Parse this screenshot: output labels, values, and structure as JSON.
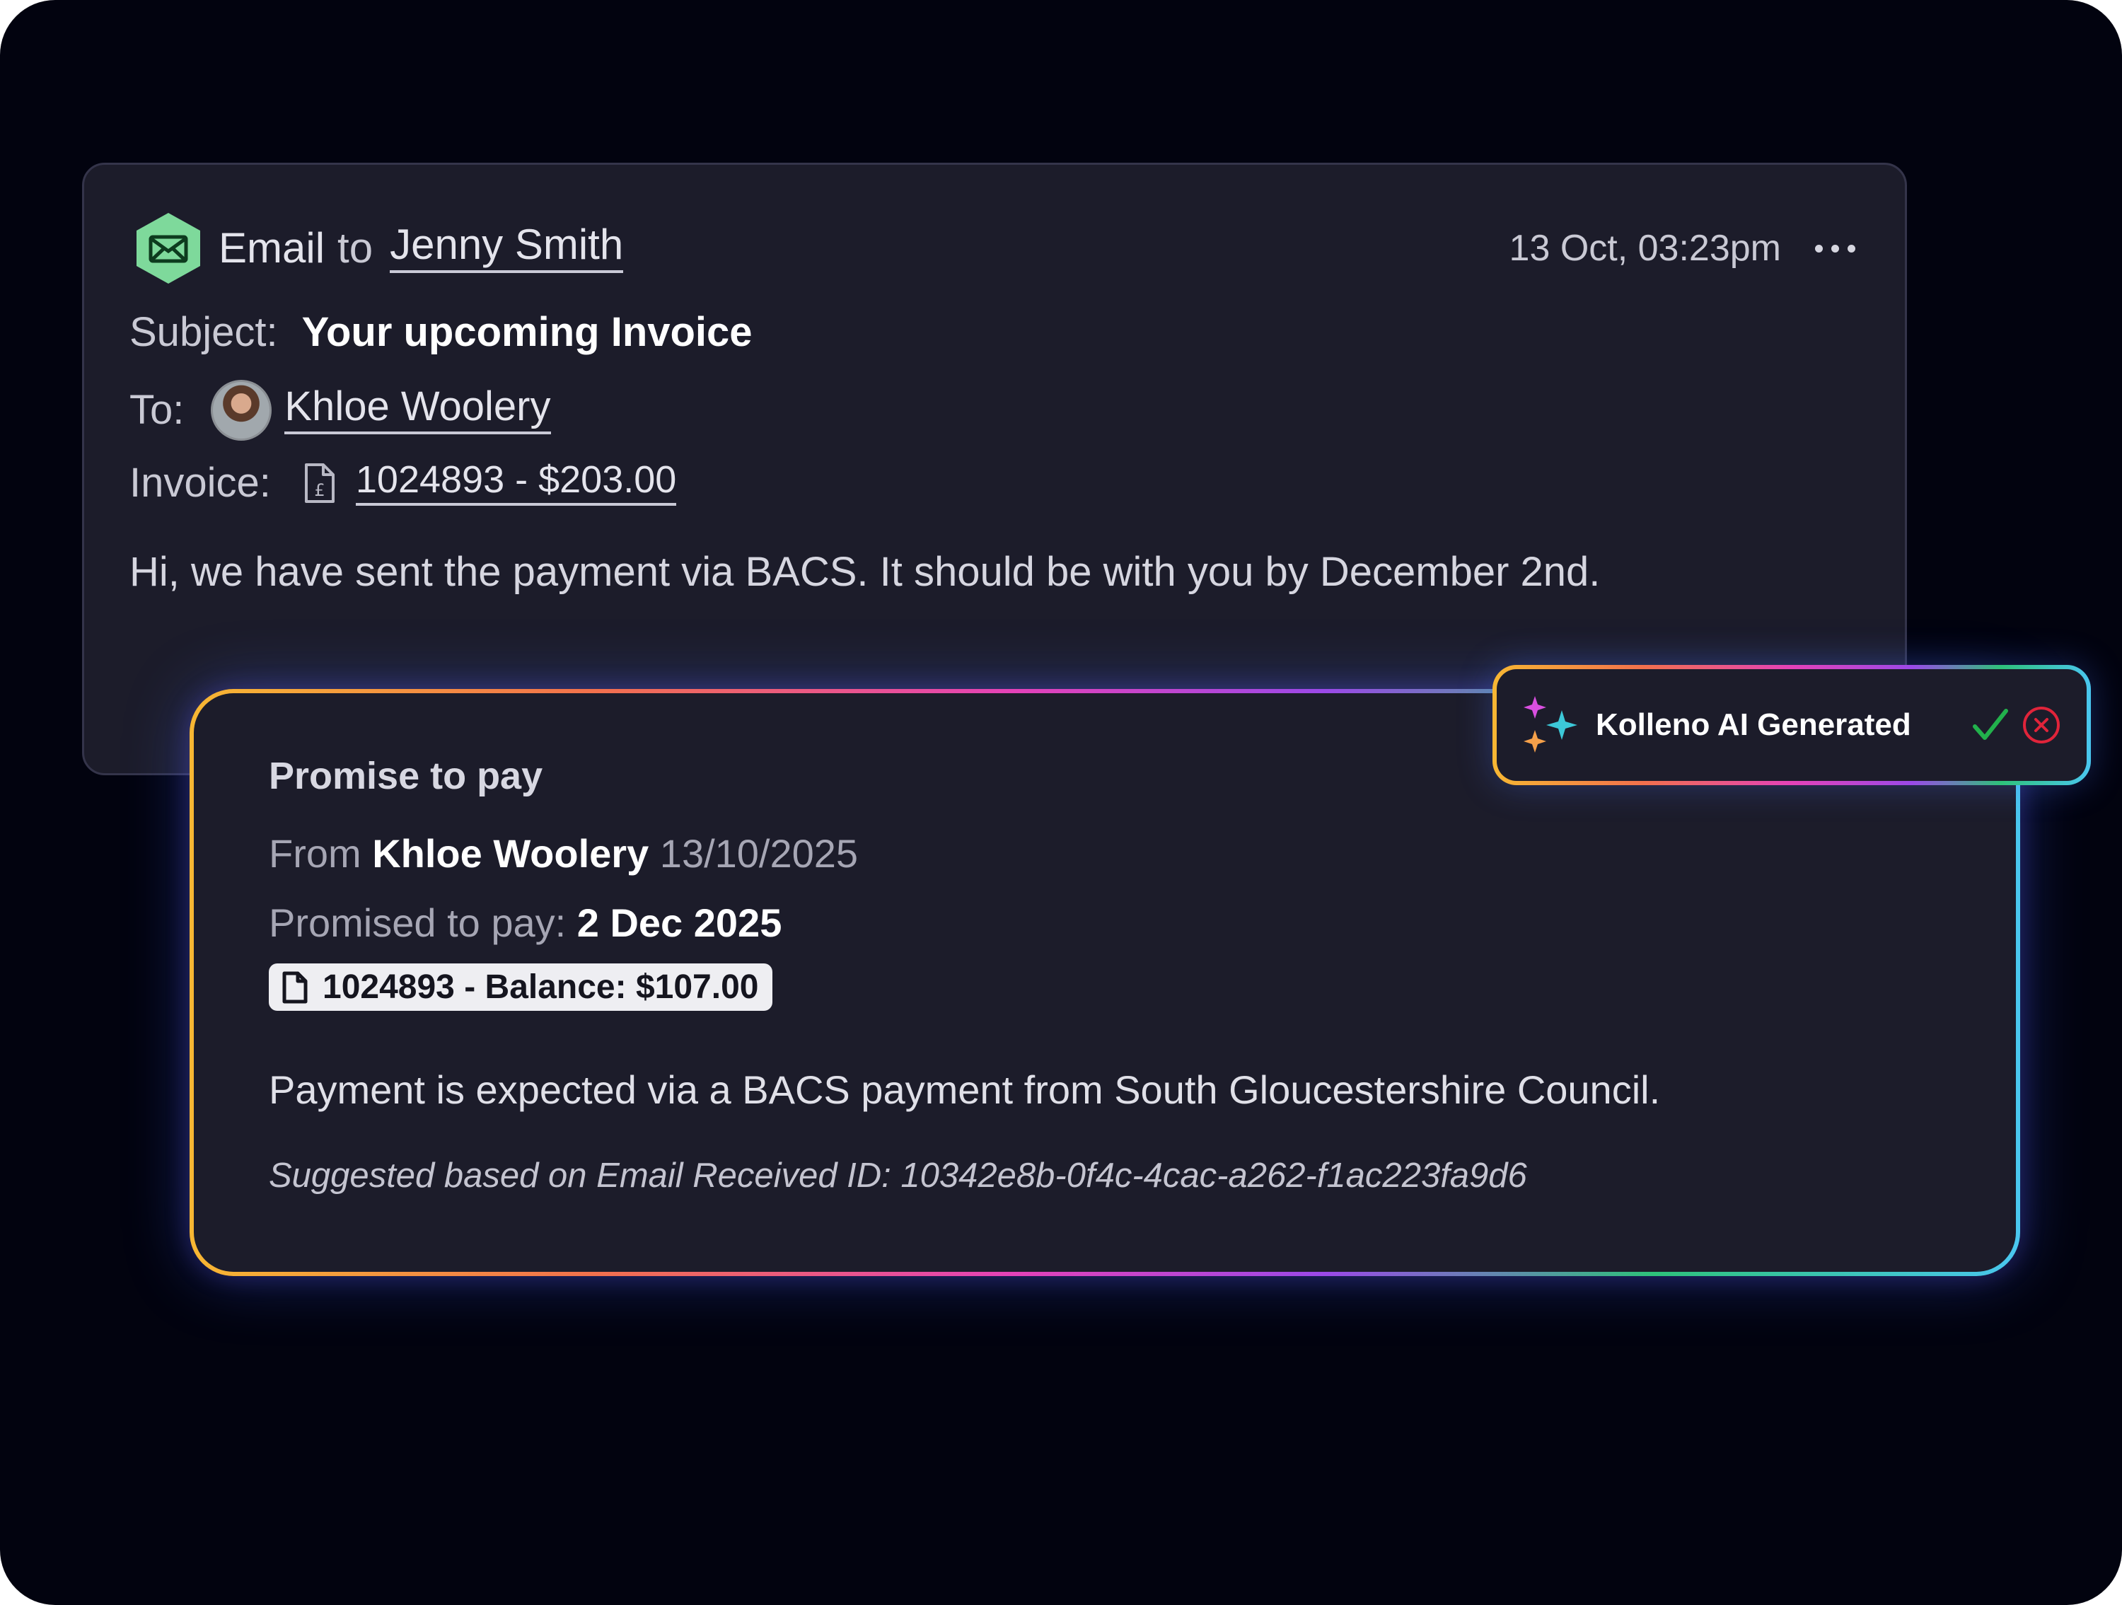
{
  "email": {
    "title_prefix": "Email",
    "to_word": "to",
    "recipient": "Jenny Smith",
    "timestamp": "13 Oct, 03:23pm",
    "menu_icon": "more-horizontal-icon",
    "header_icon": "email-envelope-icon",
    "subject_label": "Subject:",
    "subject_value": "Your upcoming Invoice",
    "to_label": "To:",
    "to_contact": "Khloe Woolery",
    "invoice_label": "Invoice:",
    "invoice_link": "1024893 - $203.00",
    "body": "Hi, we have sent the payment via BACS. It should be with you by December 2nd."
  },
  "promise": {
    "title": "Promise to pay",
    "from_label": "From",
    "from_name": "Khloe Woolery",
    "from_date": "13/10/2025",
    "promised_label": "Promised to pay:",
    "promised_date": "2 Dec 2025",
    "chip_label": "1024893 - Balance: $107.00",
    "description": "Payment is expected via a BACS payment from South Gloucestershire Council.",
    "note": "Suggested based on Email Received ID: 10342e8b-0f4c-4cac-a262-f1ac223fa9d6"
  },
  "ai_badge": {
    "label": "Kolleno AI Generated",
    "icons": [
      "sparkle-icon",
      "check-icon",
      "close-circle-icon"
    ]
  },
  "colors": {
    "background": "#02030f",
    "card": "#1c1c2a",
    "email_icon_green": "#7ed99b",
    "approve_green": "#22b14c",
    "reject_red": "#e0243a",
    "gradient": [
      "#f7b733",
      "#f2714c",
      "#e442b8",
      "#9b49e8",
      "#2ec27a",
      "#4ac7f0"
    ]
  }
}
